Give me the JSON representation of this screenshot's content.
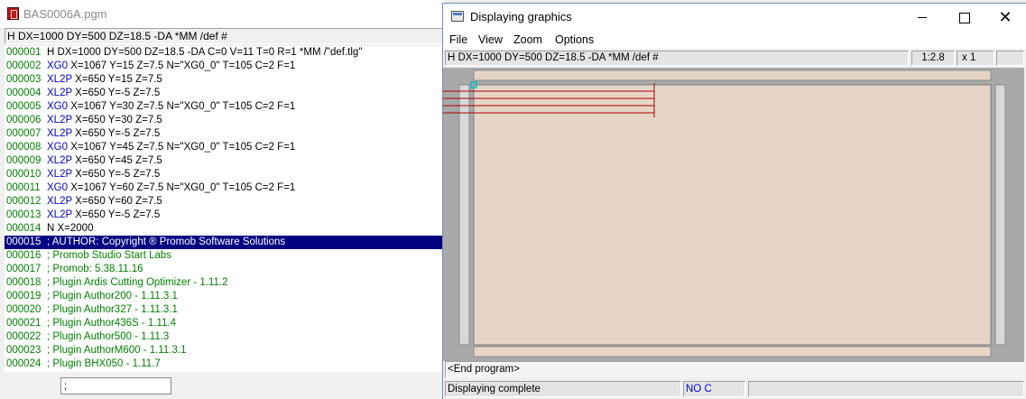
{
  "editor": {
    "title": "BAS0006A.pgm",
    "header": "H DX=1000 DY=500 DZ=18.5 -DA *MM /def #",
    "lines": [
      {
        "num": "000001",
        "code": "",
        "text": "H DX=1000 DY=500 DZ=18.5 -DA C=0 V=11 T=0 R=1 *MM /\"def.tlg\""
      },
      {
        "num": "000002",
        "code": "XG0",
        "text": "X=1067 Y=15 Z=7.5 N=\"XG0_0\" T=105 C=2 F=1"
      },
      {
        "num": "000003",
        "code": "XL2P",
        "text": "X=650 Y=15 Z=7.5"
      },
      {
        "num": "000004",
        "code": "XL2P",
        "text": "X=650 Y=-5 Z=7.5"
      },
      {
        "num": "000005",
        "code": "XG0",
        "text": "X=1067 Y=30 Z=7.5 N=\"XG0_0\" T=105 C=2 F=1"
      },
      {
        "num": "000006",
        "code": "XL2P",
        "text": "X=650 Y=30 Z=7.5"
      },
      {
        "num": "000007",
        "code": "XL2P",
        "text": "X=650 Y=-5 Z=7.5"
      },
      {
        "num": "000008",
        "code": "XG0",
        "text": "X=1067 Y=45 Z=7.5 N=\"XG0_0\" T=105 C=2 F=1"
      },
      {
        "num": "000009",
        "code": "XL2P",
        "text": "X=650 Y=45 Z=7.5"
      },
      {
        "num": "000010",
        "code": "XL2P",
        "text": "X=650 Y=-5 Z=7.5"
      },
      {
        "num": "000011",
        "code": "XG0",
        "text": "X=1067 Y=60 Z=7.5 N=\"XG0_0\" T=105 C=2 F=1"
      },
      {
        "num": "000012",
        "code": "XL2P",
        "text": "X=650 Y=60 Z=7.5"
      },
      {
        "num": "000013",
        "code": "XL2P",
        "text": "X=650 Y=-5 Z=7.5"
      },
      {
        "num": "000014",
        "code": "",
        "text": "N X=2000"
      },
      {
        "num": "000015",
        "code": "",
        "text": "; AUTHOR: Copyright ® Promob Software Solutions",
        "selected": true
      },
      {
        "num": "000016",
        "code": "",
        "text": "; Promob Studio Start Labs",
        "comment": true
      },
      {
        "num": "000017",
        "code": "",
        "text": "; Promob: 5.38.11.16",
        "comment": true
      },
      {
        "num": "000018",
        "code": "",
        "text": "; Plugin Ardis Cutting Optimizer - 1.11.2",
        "comment": true
      },
      {
        "num": "000019",
        "code": "",
        "text": "; Plugin Author200 - 1.11.3.1",
        "comment": true
      },
      {
        "num": "000020",
        "code": "",
        "text": "; Plugin Author327 - 1.11.3.1",
        "comment": true
      },
      {
        "num": "000021",
        "code": "",
        "text": "; Plugin Author436S - 1.11.4",
        "comment": true
      },
      {
        "num": "000022",
        "code": "",
        "text": "; Plugin Author500 - 1.11.3",
        "comment": true
      },
      {
        "num": "000023",
        "code": "",
        "text": "; Plugin AuthorM600 - 1.11.3.1",
        "comment": true
      },
      {
        "num": "000024",
        "code": "",
        "text": "; Plugin BHX050 - 1.11.7",
        "comment": true
      }
    ],
    "command_input": ";"
  },
  "graphics": {
    "title": "Displaying graphics",
    "menu": {
      "file": "File",
      "view": "View",
      "zoom": "Zoom",
      "options": "Options"
    },
    "command_line": "H DX=1000 DY=500 DZ=18.5 -DA *MM /def #",
    "scale": "1:2.8",
    "factor": "x 1",
    "program_status": "<End program>",
    "status_message": "Displaying complete",
    "status_mode": "NO C",
    "colors": {
      "panel": "#e6d5c7",
      "background": "#a9a9a9",
      "rail": "#d8d8d8",
      "toolpath": "#b00000",
      "origin": "#00c0c0"
    }
  }
}
